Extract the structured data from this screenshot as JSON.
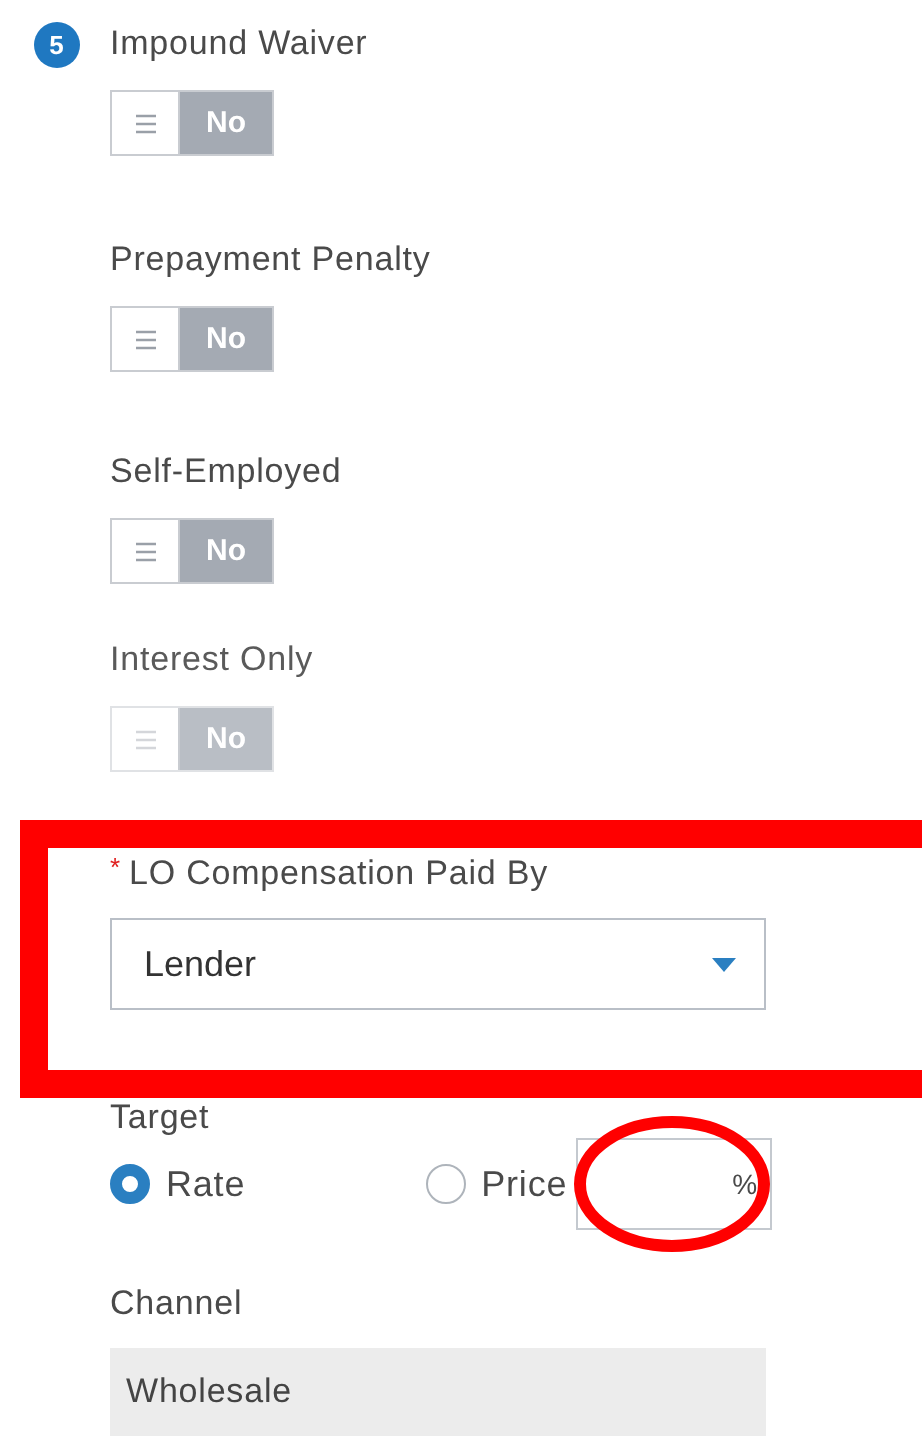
{
  "step": {
    "number": "5"
  },
  "toggles": [
    {
      "label": "Impound Waiver",
      "value": "No",
      "on": false,
      "disabled": false
    },
    {
      "label": "Prepayment Penalty",
      "value": "No",
      "on": false,
      "disabled": false
    },
    {
      "label": "Self-Employed",
      "value": "No",
      "on": false,
      "disabled": false
    },
    {
      "label": "Interest Only",
      "value": "No",
      "on": false,
      "disabled": true
    }
  ],
  "lo_compensation": {
    "label": "LO Compensation Paid By",
    "required": true,
    "required_marker": "*",
    "value": "Lender"
  },
  "target": {
    "label": "Target",
    "options": [
      {
        "label": "Rate",
        "selected": true
      },
      {
        "label": "Price",
        "selected": false
      }
    ],
    "percent_field": {
      "unit": "%"
    }
  },
  "channel": {
    "label": "Channel",
    "value": "Wholesale",
    "disabled": true
  },
  "annotations": [
    {
      "kind": "rectangle",
      "color": "#ff0000"
    },
    {
      "kind": "ellipse",
      "color": "#ff0000"
    }
  ]
}
